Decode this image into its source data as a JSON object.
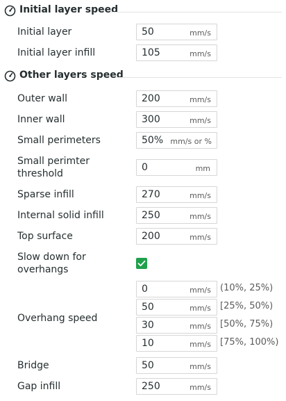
{
  "sections": {
    "initial": {
      "title": "Initial layer speed",
      "icon": "gauge-icon"
    },
    "other": {
      "title": "Other layers speed",
      "icon": "gauge-icon"
    }
  },
  "rows": {
    "initial_layer": {
      "label": "Initial layer",
      "value": "50",
      "unit": "mm/s"
    },
    "initial_layer_infill": {
      "label": "Initial layer infill",
      "value": "105",
      "unit": "mm/s"
    },
    "outer_wall": {
      "label": "Outer wall",
      "value": "200",
      "unit": "mm/s"
    },
    "inner_wall": {
      "label": "Inner wall",
      "value": "300",
      "unit": "mm/s"
    },
    "small_perimeters": {
      "label": "Small perimeters",
      "value": "50%",
      "unit": "mm/s or %"
    },
    "small_perimeter_threshold": {
      "label_line1": "Small perimter",
      "label_line2": "threshold",
      "value": "0",
      "unit": "mm"
    },
    "sparse_infill": {
      "label": "Sparse infill",
      "value": "270",
      "unit": "mm/s"
    },
    "internal_solid_infill": {
      "label": "Internal solid infill",
      "value": "250",
      "unit": "mm/s"
    },
    "top_surface": {
      "label": "Top surface",
      "value": "200",
      "unit": "mm/s"
    },
    "slow_down_overhangs": {
      "label_line1": "Slow down for",
      "label_line2": "overhangs",
      "checked": true
    },
    "overhang_speed": {
      "label": "Overhang speed",
      "items": [
        {
          "value": "0",
          "unit": "mm/s",
          "range": "(10%, 25%)"
        },
        {
          "value": "50",
          "unit": "mm/s",
          "range": "[25%, 50%)"
        },
        {
          "value": "30",
          "unit": "mm/s",
          "range": "[50%, 75%)"
        },
        {
          "value": "10",
          "unit": "mm/s",
          "range": "[75%, 100%)"
        }
      ]
    },
    "bridge": {
      "label": "Bridge",
      "value": "50",
      "unit": "mm/s"
    },
    "gap_infill": {
      "label": "Gap infill",
      "value": "250",
      "unit": "mm/s"
    }
  },
  "colors": {
    "accent": "#1fa04a",
    "text": "#262e30",
    "border": "#d6d6d6"
  }
}
